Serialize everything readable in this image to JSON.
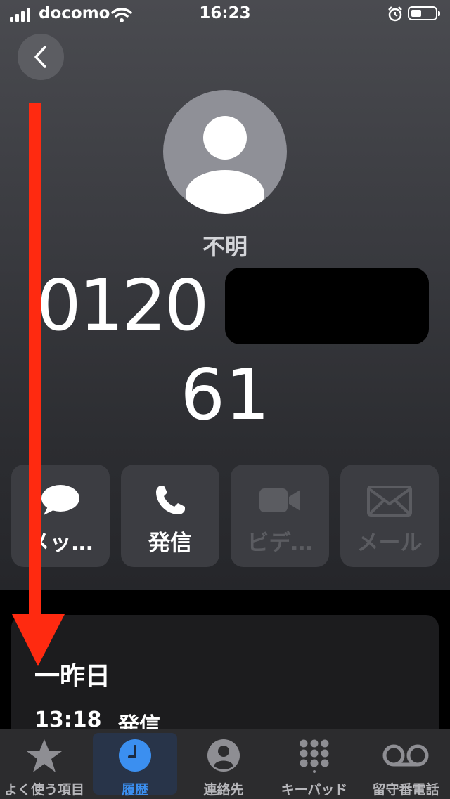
{
  "status_bar": {
    "carrier": "docomo",
    "time": "16:23"
  },
  "contact": {
    "name": "不明",
    "number_line1": "0120",
    "number_line2": "61"
  },
  "actions": [
    {
      "label": "メッ…",
      "icon": "message-bubble-icon",
      "enabled": true
    },
    {
      "label": "発信",
      "icon": "phone-icon",
      "enabled": true
    },
    {
      "label": "ビデ…",
      "icon": "video-camera-icon",
      "enabled": false
    },
    {
      "label": "メール",
      "icon": "mail-icon",
      "enabled": false
    }
  ],
  "history": {
    "date": "一昨日",
    "time": "13:18",
    "type": "発信"
  },
  "tabbar": {
    "tabs": [
      {
        "label": "よく使う項目",
        "icon": "star-icon"
      },
      {
        "label": "履歴",
        "icon": "clock-icon",
        "active": true
      },
      {
        "label": "連絡先",
        "icon": "person-circle-icon"
      },
      {
        "label": "キーパッド",
        "icon": "keypad-icon"
      },
      {
        "label": "留守番電話",
        "icon": "voicemail-icon"
      }
    ]
  },
  "colors": {
    "accent": "#3b8ff0",
    "annotation_arrow": "#ff2a10",
    "button_bg": "#3c3d42",
    "card_bg": "#1c1c1e"
  }
}
